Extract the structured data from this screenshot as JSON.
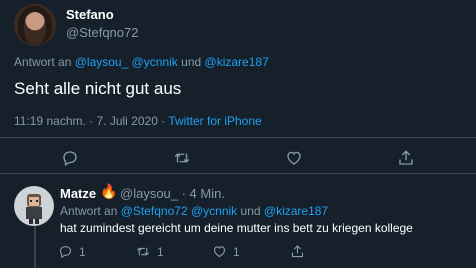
{
  "main_tweet": {
    "display_name": "Stefano",
    "handle": "@Stefqno72",
    "reply_prefix": "Antwort an",
    "reply_to_1": "@laysou_",
    "reply_to_2": "@ycnnik",
    "reply_connector": "und",
    "reply_to_3": "@kizare187",
    "text": "Seht alle nicht gut aus",
    "time": "11:19 nachm. · 7. Juli 2020 ·",
    "source": "Twitter for iPhone"
  },
  "reply_tweet": {
    "display_name": "Matze",
    "emoji": "🔥",
    "handle_time": "@laysou_ · 4 Min.",
    "reply_prefix": "Antwort an",
    "reply_to_1": "@Stefqno72",
    "reply_to_2": "@ycnnik",
    "reply_connector": "und",
    "reply_to_3": "@kizare187",
    "text": "hat zumindest gereicht um deine mutter ins bett zu kriegen kollege",
    "reply_count": "1",
    "retweet_count": "1",
    "like_count": "1"
  },
  "icons": [
    "reply-icon",
    "retweet-icon",
    "like-icon",
    "share-icon"
  ],
  "colors": {
    "background": "#15202b",
    "accent": "#1da1f2",
    "muted": "#8899a6",
    "divider": "#38444d"
  }
}
